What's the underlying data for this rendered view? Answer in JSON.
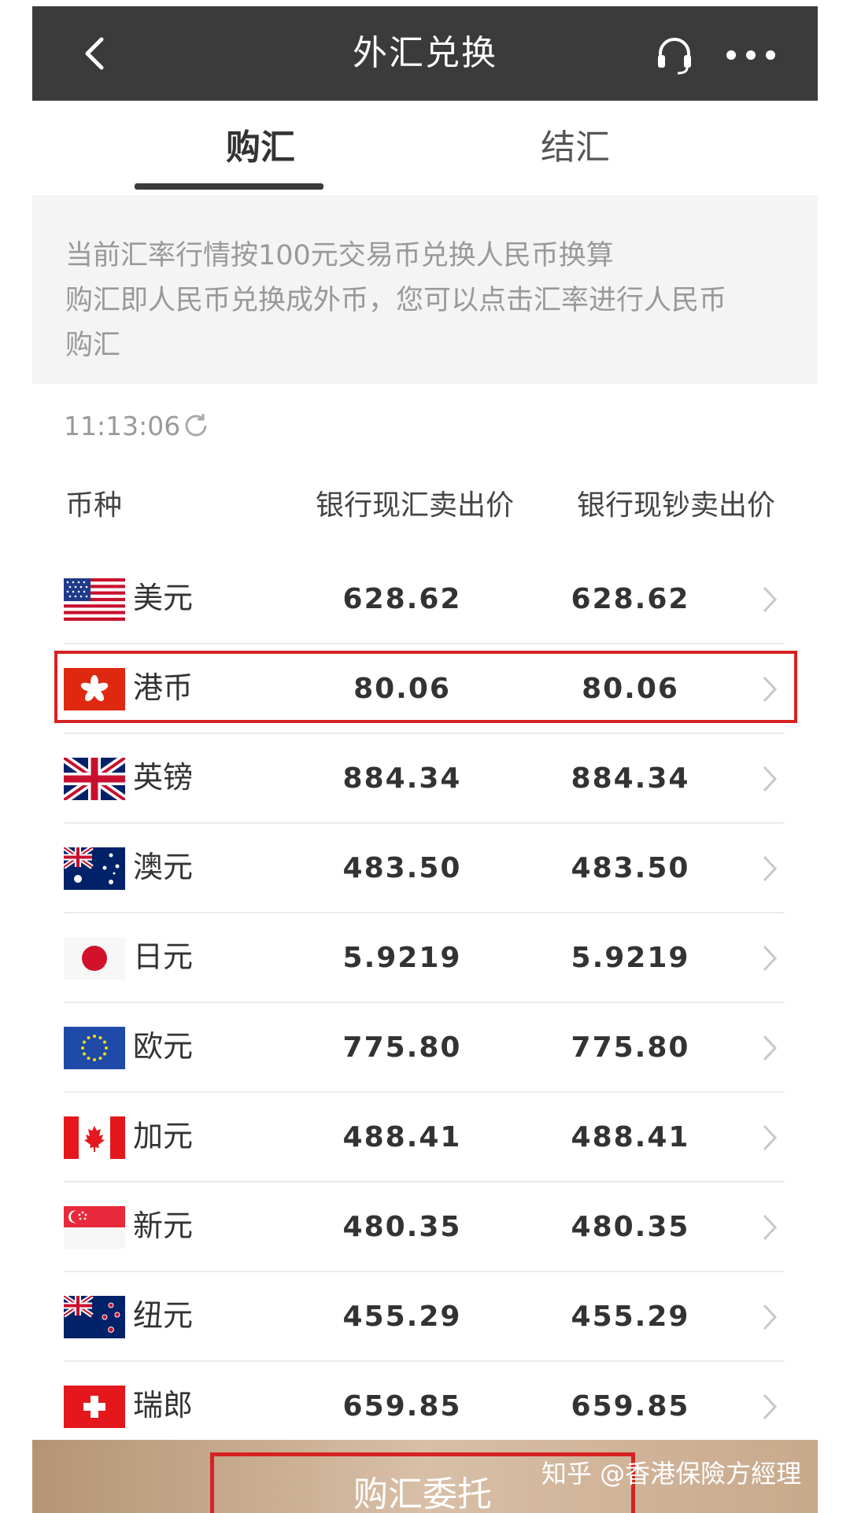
{
  "header": {
    "title": "外汇兑换"
  },
  "tabs": [
    {
      "label": "购汇",
      "active": true
    },
    {
      "label": "结汇",
      "active": false
    }
  ],
  "notice": {
    "line1": "当前汇率行情按100元交易币兑换人民币换算",
    "line2": "购汇即人民币兑换成外币，您可以点击汇率进行人民币",
    "line3": "购汇"
  },
  "timestamp": "11:13:06",
  "table": {
    "headers": {
      "currency": "币种",
      "spot_sell": "银行现汇卖出价",
      "cash_sell": "银行现钞卖出价"
    },
    "rows": [
      {
        "flag": "us-flag-icon",
        "name": "美元",
        "spot": "628.62",
        "cash": "628.62"
      },
      {
        "flag": "hk-flag-icon",
        "name": "港币",
        "spot": "80.06",
        "cash": "80.06",
        "highlighted": true
      },
      {
        "flag": "uk-flag-icon",
        "name": "英镑",
        "spot": "884.34",
        "cash": "884.34"
      },
      {
        "flag": "au-flag-icon",
        "name": "澳元",
        "spot": "483.50",
        "cash": "483.50"
      },
      {
        "flag": "jp-flag-icon",
        "name": "日元",
        "spot": "5.9219",
        "cash": "5.9219"
      },
      {
        "flag": "eu-flag-icon",
        "name": "欧元",
        "spot": "775.80",
        "cash": "775.80"
      },
      {
        "flag": "ca-flag-icon",
        "name": "加元",
        "spot": "488.41",
        "cash": "488.41"
      },
      {
        "flag": "sg-flag-icon",
        "name": "新元",
        "spot": "480.35",
        "cash": "480.35"
      },
      {
        "flag": "nz-flag-icon",
        "name": "纽元",
        "spot": "455.29",
        "cash": "455.29"
      },
      {
        "flag": "ch-flag-icon",
        "name": "瑞郎",
        "spot": "659.85",
        "cash": "659.85"
      }
    ]
  },
  "bottom": {
    "button_label": "购汇委托",
    "watermark": "知乎 @香港保險方經理"
  },
  "colors": {
    "header_bg": "#3b3b3b",
    "highlight": "#d62222",
    "bottom_bar": "#c8a98c"
  }
}
